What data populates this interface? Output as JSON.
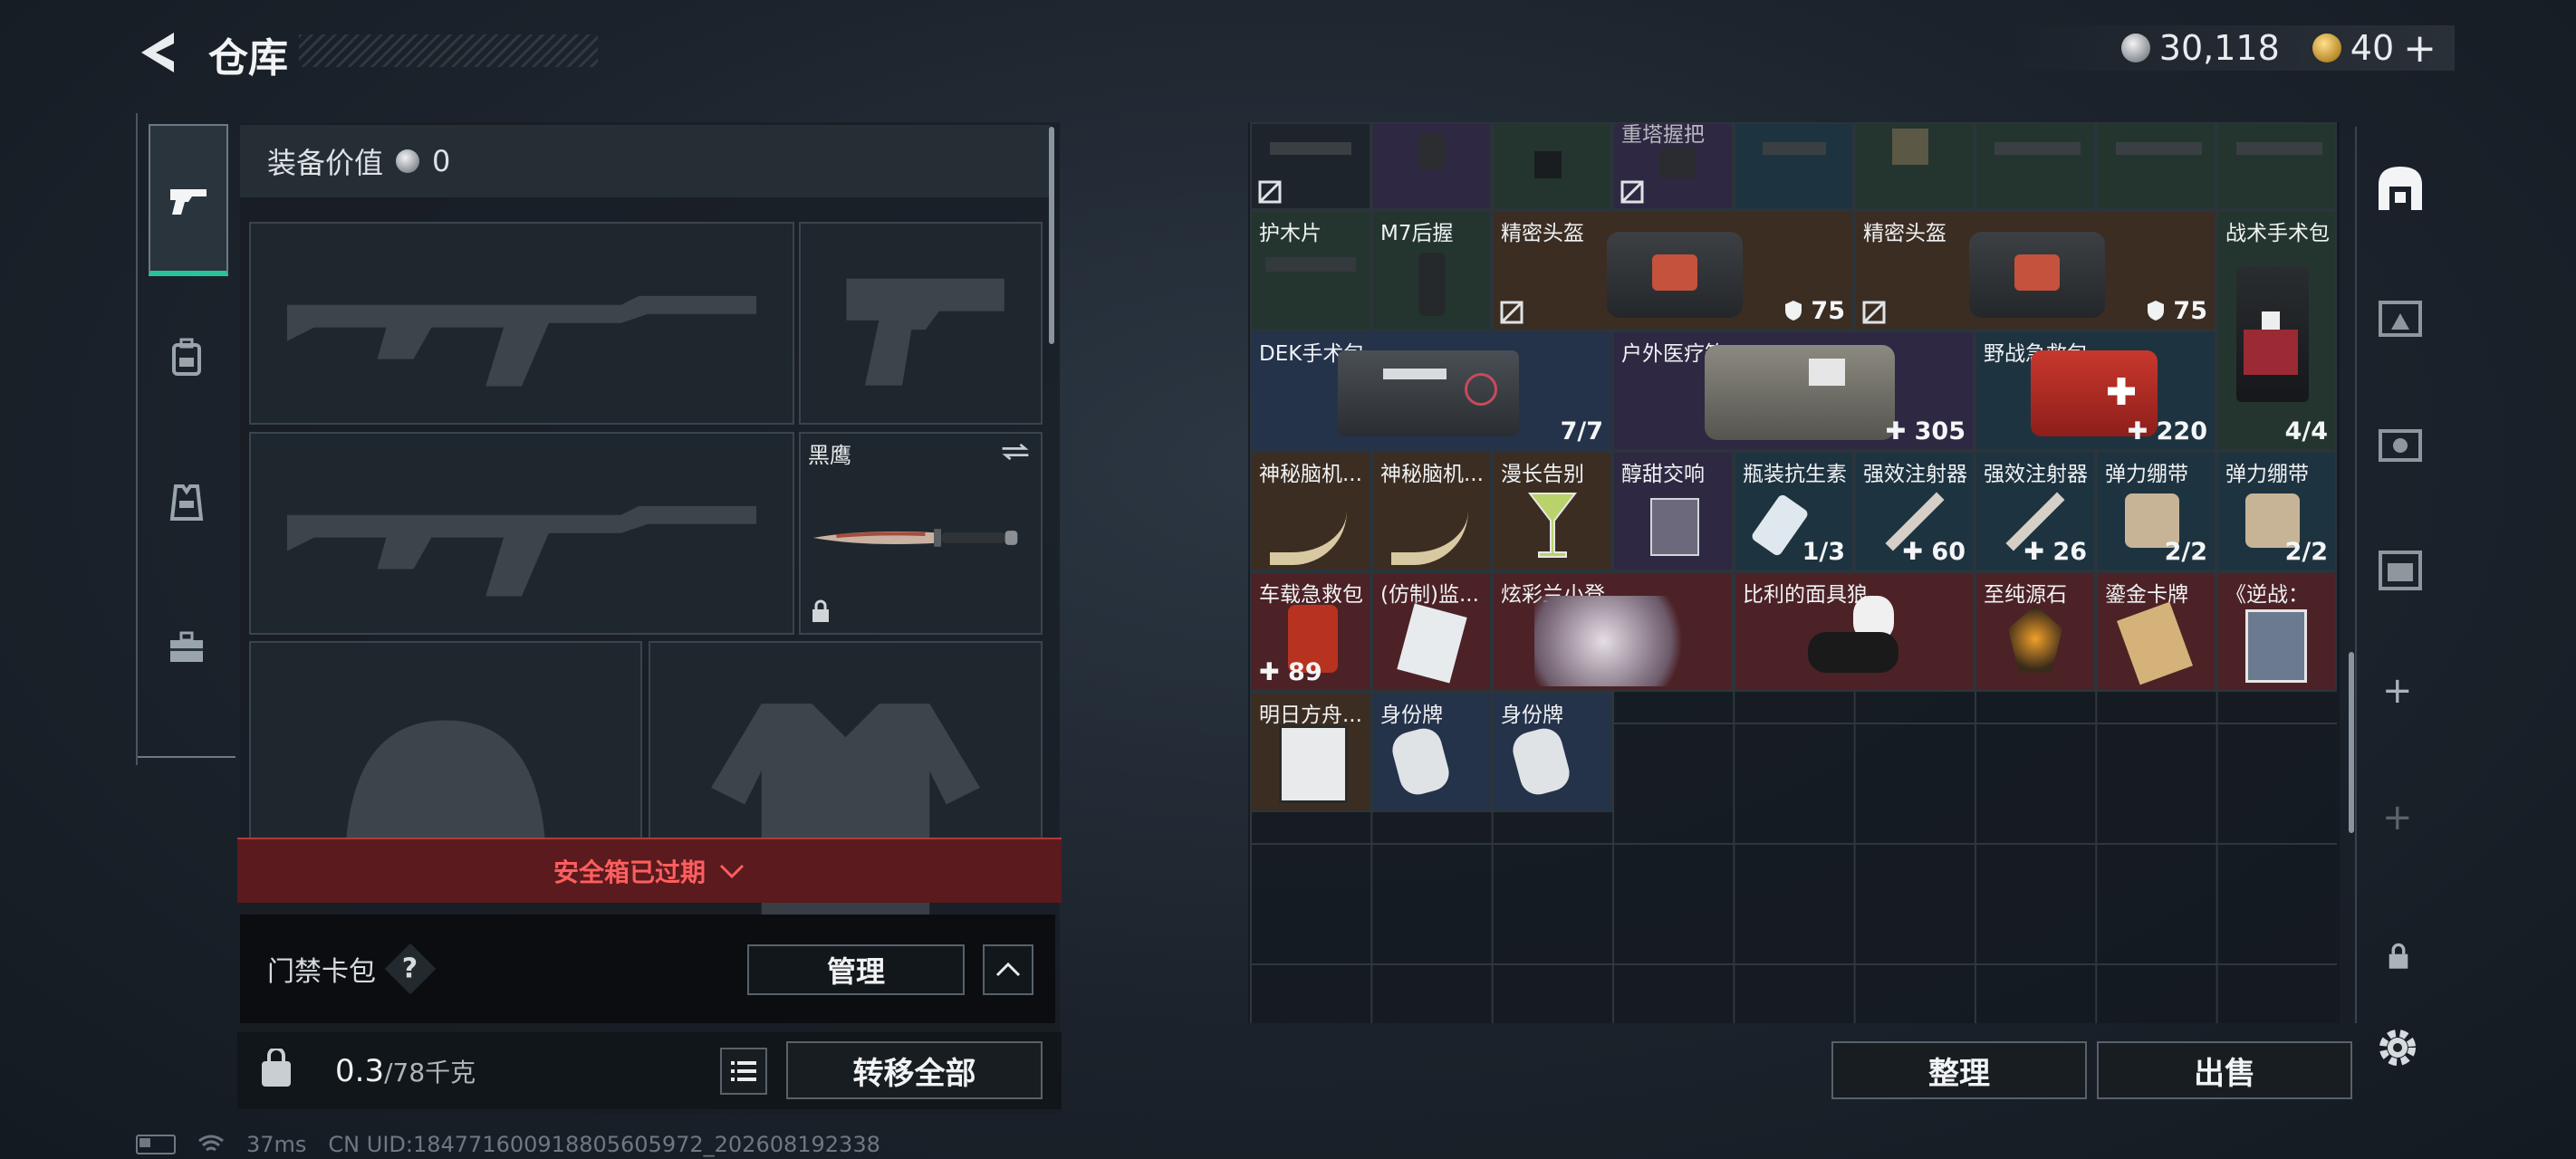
{
  "header": {
    "title": "仓库",
    "currency_silver": "30,118",
    "currency_gold": "40",
    "add_symbol": "+"
  },
  "loadout": {
    "equip_value_label": "装备价值",
    "equip_value": "0",
    "knife_name": "黑鹰",
    "safebox_status": "安全箱已过期",
    "keycard_label": "门禁卡包",
    "help_symbol": "?",
    "manage_label": "管理",
    "weight_value": "0.3",
    "weight_capacity": "/78千克",
    "transfer_all_label": "转移全部"
  },
  "stash": {
    "items": [
      {
        "label": "",
        "count": ""
      },
      {
        "label": "",
        "count": ""
      },
      {
        "label": "",
        "count": ""
      },
      {
        "label": "重塔握把",
        "count": ""
      },
      {
        "label": "护木片",
        "count": ""
      },
      {
        "label": "M7后握",
        "count": ""
      },
      {
        "label": "精密头盔",
        "count": "75"
      },
      {
        "label": "精密头盔",
        "count": "75"
      },
      {
        "label": "战术手术包",
        "count": ""
      },
      {
        "label": "DEK手术包",
        "count": "7/7"
      },
      {
        "label": "户外医疗箱",
        "count": "305"
      },
      {
        "label": "野战急救包",
        "count": "220"
      },
      {
        "label": "",
        "count": "4/4"
      },
      {
        "label": "神秘脑机...",
        "count": ""
      },
      {
        "label": "神秘脑机...",
        "count": ""
      },
      {
        "label": "漫长告别",
        "count": ""
      },
      {
        "label": "醇甜交响",
        "count": ""
      },
      {
        "label": "瓶装抗生素",
        "count": "1/3"
      },
      {
        "label": "强效注射器",
        "count": "60"
      },
      {
        "label": "强效注射器",
        "count": "26"
      },
      {
        "label": "弹力绷带",
        "count": "2/2"
      },
      {
        "label": "弹力绷带",
        "count": "2/2"
      },
      {
        "label": "车载急救包",
        "count": "89"
      },
      {
        "label": "(仿制)监...",
        "count": ""
      },
      {
        "label": "炫彩兰小登",
        "count": ""
      },
      {
        "label": "比利的面具狼",
        "count": ""
      },
      {
        "label": "至纯源石",
        "count": ""
      },
      {
        "label": "鎏金卡牌",
        "count": ""
      },
      {
        "label": "《逆战：",
        "count": ""
      },
      {
        "label": "明日方舟...",
        "count": ""
      },
      {
        "label": "身份牌",
        "count": ""
      },
      {
        "label": "身份牌",
        "count": ""
      }
    ],
    "tidy_label": "整理",
    "sell_label": "出售",
    "rail_add_1": "+",
    "rail_add_2": "+"
  },
  "status_bar": {
    "ping": "37ms",
    "uid": "CN UID:18477160091880560​5972_202608192338"
  },
  "colors": {
    "accent_green": "#27c49a",
    "expired_red": "#ff5e5e"
  },
  "icons": [
    "back-arrow-icon",
    "pistol-icon",
    "backpack-icon",
    "vest-icon",
    "toolbox-icon",
    "silver-coin-icon",
    "gold-coin-icon",
    "swap-icon",
    "lock-icon",
    "chevron-down-icon",
    "chevron-up-icon",
    "list-icon",
    "bag-weight-icon",
    "no-sale-icon",
    "shield-icon",
    "plus-icon",
    "settings-gear-icon",
    "battery-icon",
    "wifi-icon"
  ]
}
